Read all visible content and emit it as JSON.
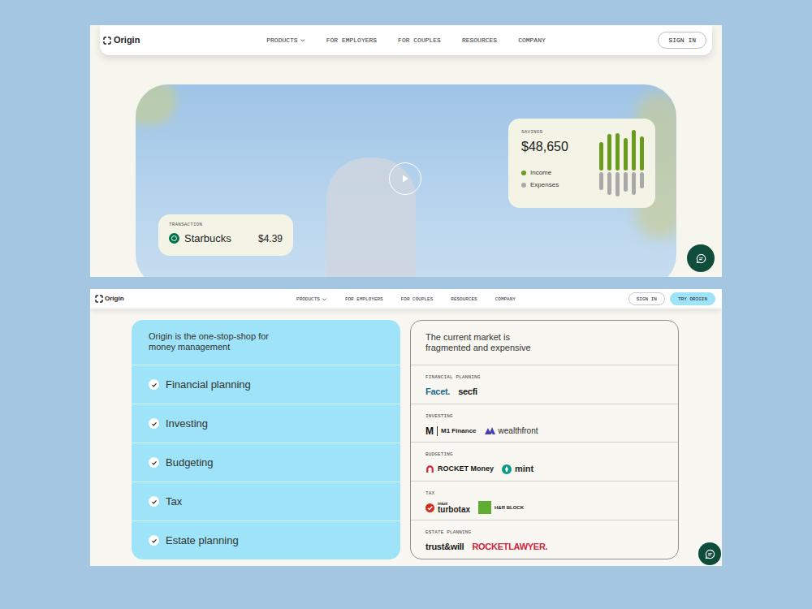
{
  "top_screen": {
    "nav": {
      "logo": "Origin",
      "items": [
        {
          "label": "PRODUCTS",
          "has_menu": true
        },
        {
          "label": "FOR EMPLOYERS",
          "has_menu": false
        },
        {
          "label": "FOR COUPLES",
          "has_menu": false
        },
        {
          "label": "RESOURCES",
          "has_menu": false
        },
        {
          "label": "COMPANY",
          "has_menu": false
        }
      ],
      "buttons": [
        {
          "label": "SIGN IN",
          "primary": false
        }
      ]
    },
    "transaction": {
      "label": "TRANSACTION",
      "merchant": "Starbucks",
      "amount": "$4.39"
    },
    "savings": {
      "label": "SAVINGS",
      "amount": "$48,650",
      "legend": [
        {
          "label": "Income",
          "color": "#6a9a1f"
        },
        {
          "label": "Expenses",
          "color": "#a9a9a9"
        }
      ],
      "income": [
        35,
        45,
        46,
        40,
        50,
        42
      ],
      "expenses": [
        22,
        28,
        30,
        24,
        28,
        20
      ]
    }
  },
  "bottom_screen": {
    "nav": {
      "logo": "Origin",
      "items": [
        {
          "label": "PRODUCTS",
          "has_menu": true
        },
        {
          "label": "FOR EMPLOYERS",
          "has_menu": false
        },
        {
          "label": "FOR COUPLES",
          "has_menu": false
        },
        {
          "label": "RESOURCES",
          "has_menu": false
        },
        {
          "label": "COMPANY",
          "has_menu": false
        }
      ],
      "buttons": [
        {
          "label": "SIGN IN",
          "primary": false
        },
        {
          "label": "TRY ORIGIN",
          "primary": true
        }
      ]
    },
    "origin_panel": {
      "title": "Origin is the one-stop-shop for money management",
      "features": [
        {
          "label": "Financial planning",
          "checked": true
        },
        {
          "label": "Investing",
          "checked": true
        },
        {
          "label": "Budgeting",
          "checked": true
        },
        {
          "label": "Tax",
          "checked": true
        },
        {
          "label": "Estate planning",
          "checked": true
        }
      ]
    },
    "market_panel": {
      "title": "The current market is fragmented and expensive",
      "categories": [
        {
          "label": "FINANCIAL PLANNING",
          "logos": [
            {
              "name": "Facet.",
              "kind": "wordmark",
              "color": "#1e6b8c"
            },
            {
              "name": "secfi",
              "kind": "wordmark",
              "color": "#1a1a1a"
            }
          ]
        },
        {
          "label": "INVESTING",
          "logos": [
            {
              "name": "M1 Finance",
              "mark": "M",
              "kind": "mark-divider",
              "color": "#1a1a1a"
            },
            {
              "name": "wealthfront",
              "kind": "wealthfront",
              "color": "#2b2b2b"
            }
          ]
        },
        {
          "label": "BUDGETING",
          "logos": [
            {
              "name": "ROCKET Money",
              "kind": "rocket",
              "color": "#1a1a1a"
            },
            {
              "name": "mint",
              "kind": "mint",
              "color": "#1f2a2a"
            }
          ]
        },
        {
          "label": "TAX",
          "logos": [
            {
              "name": "turbotax",
              "sup": "intuit",
              "kind": "turbotax",
              "color": "#1a1a1a"
            },
            {
              "name": "H&R BLOCK",
              "kind": "square",
              "color": "#1a1a1a"
            }
          ]
        },
        {
          "label": "ESTATE PLANNING",
          "logos": [
            {
              "name": "trust&will",
              "kind": "wordmark",
              "color": "#1a1a1a"
            },
            {
              "name": "ROCKETLAWYER.",
              "kind": "wordmark",
              "color": "#d2233c"
            }
          ]
        }
      ]
    }
  }
}
